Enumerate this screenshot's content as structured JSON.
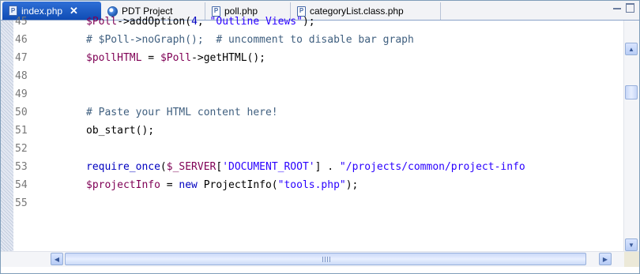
{
  "tabs": [
    {
      "label": "index.php",
      "icon": "php-file-icon",
      "active": true,
      "close": "✕"
    },
    {
      "label": "PDT Project",
      "icon": "globe-icon",
      "active": false
    },
    {
      "label": "poll.php",
      "icon": "php-file-icon",
      "active": false
    },
    {
      "label": "categoryList.class.php",
      "icon": "php-file-icon",
      "active": false
    }
  ],
  "file_icon_glyph": "P",
  "colors": {
    "active_tab": "#1a56c4",
    "variable": "#7f0055",
    "comment": "#3f5f7f",
    "string": "#2a00ff",
    "keyword": "#0000c0",
    "line_number": "#787878"
  },
  "code_lines": [
    {
      "num": "45",
      "tokens": [
        {
          "t": "var",
          "v": "$Poll"
        },
        {
          "t": "fn",
          "v": "->addOption("
        },
        {
          "t": "kw",
          "v": "4"
        },
        {
          "t": "fn",
          "v": ", "
        },
        {
          "t": "str",
          "v": "\"Outline Views\""
        },
        {
          "t": "fn",
          "v": ");"
        }
      ]
    },
    {
      "num": "46",
      "tokens": [
        {
          "t": "comment",
          "v": "# $Poll->noGraph();  # uncomment to disable bar graph"
        }
      ]
    },
    {
      "num": "47",
      "tokens": [
        {
          "t": "var",
          "v": "$pollHTML"
        },
        {
          "t": "fn",
          "v": " = "
        },
        {
          "t": "var",
          "v": "$Poll"
        },
        {
          "t": "fn",
          "v": "->getHTML();"
        }
      ]
    },
    {
      "num": "48",
      "tokens": []
    },
    {
      "num": "49",
      "tokens": []
    },
    {
      "num": "50",
      "tokens": [
        {
          "t": "comment",
          "v": "# Paste your HTML content here!"
        }
      ]
    },
    {
      "num": "51",
      "tokens": [
        {
          "t": "fn",
          "v": "ob_start();"
        }
      ]
    },
    {
      "num": "52",
      "tokens": []
    },
    {
      "num": "53",
      "tokens": [
        {
          "t": "kw",
          "v": "require_once"
        },
        {
          "t": "fn",
          "v": "("
        },
        {
          "t": "var",
          "v": "$_SERVER"
        },
        {
          "t": "fn",
          "v": "["
        },
        {
          "t": "str",
          "v": "'DOCUMENT_ROOT'"
        },
        {
          "t": "fn",
          "v": "] . "
        },
        {
          "t": "str",
          "v": "\"/projects/common/project-info"
        }
      ]
    },
    {
      "num": "54",
      "tokens": [
        {
          "t": "var",
          "v": "$projectInfo"
        },
        {
          "t": "fn",
          "v": " = "
        },
        {
          "t": "kw",
          "v": "new"
        },
        {
          "t": "fn",
          "v": " ProjectInfo("
        },
        {
          "t": "str",
          "v": "\"tools.php\""
        },
        {
          "t": "fn",
          "v": ");"
        }
      ]
    },
    {
      "num": "55",
      "tokens": []
    }
  ]
}
